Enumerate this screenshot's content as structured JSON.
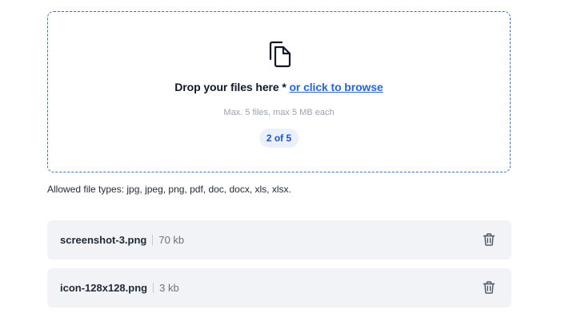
{
  "dropzone": {
    "title": "Drop your files here *",
    "browse_link": "or click to browse",
    "hint": "Max. 5 files, max 5 MB each",
    "counter": "2 of 5",
    "icon": "files-copy-icon"
  },
  "allowed_types": "Allowed file types: jpg, jpeg, png, pdf, doc, docx, xls, xlsx.",
  "files": [
    {
      "name": "screenshot-3.png",
      "size": "70 kb",
      "icon": "trash-icon"
    },
    {
      "name": "icon-128x128.png",
      "size": "3 kb",
      "icon": "trash-icon"
    }
  ],
  "colors": {
    "accent": "#2563eb",
    "border": "#2f6fd8",
    "row_bg": "#f1f3f6",
    "counter_bg": "#eaf1fd"
  }
}
